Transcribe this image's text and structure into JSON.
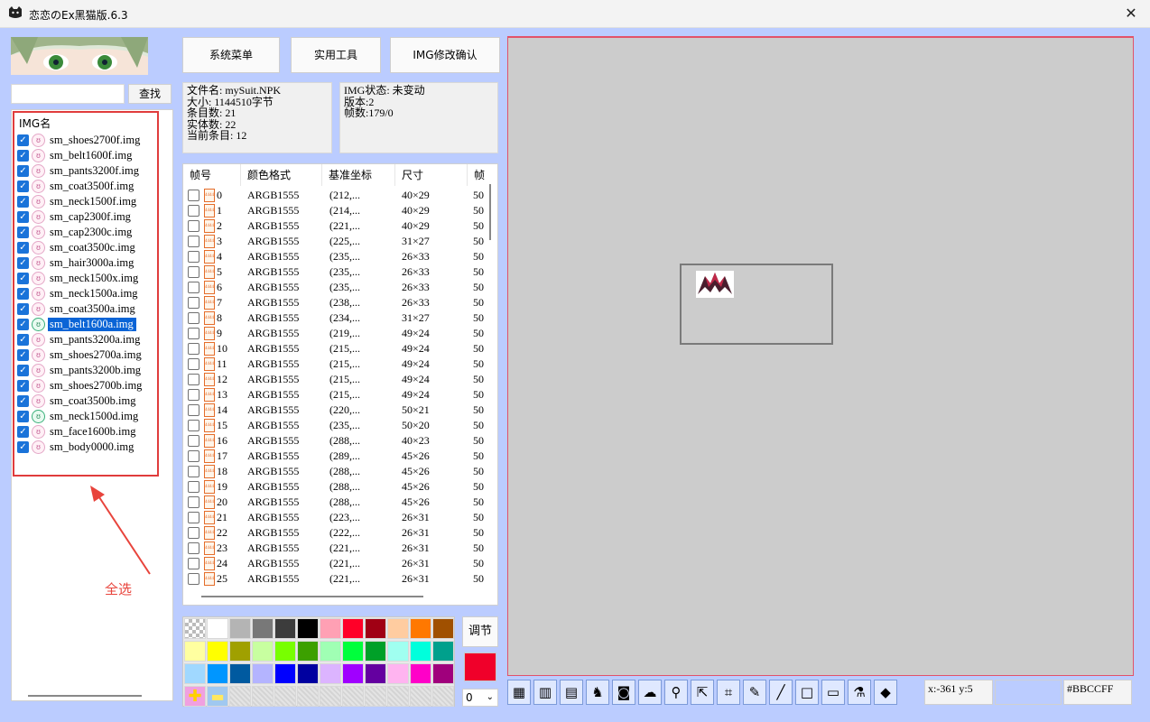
{
  "window": {
    "title": "恋恋のEx黑猫版.6.3",
    "close_symbol": "✕"
  },
  "search": {
    "value": "",
    "button_label": "查找"
  },
  "img_list": {
    "header": "IMG名",
    "items": [
      {
        "name": "sm_shoes2700f.img",
        "checked": true,
        "icon": "pig-icon"
      },
      {
        "name": "sm_belt1600f.img",
        "checked": true,
        "icon": "pig-icon"
      },
      {
        "name": "sm_pants3200f.img",
        "checked": true,
        "icon": "pig-icon"
      },
      {
        "name": "sm_coat3500f.img",
        "checked": true,
        "icon": "pig-icon"
      },
      {
        "name": "sm_neck1500f.img",
        "checked": true,
        "icon": "pig-icon"
      },
      {
        "name": "sm_cap2300f.img",
        "checked": true,
        "icon": "pig-icon"
      },
      {
        "name": "sm_cap2300c.img",
        "checked": true,
        "icon": "pig-icon"
      },
      {
        "name": "sm_coat3500c.img",
        "checked": true,
        "icon": "pig-icon"
      },
      {
        "name": "sm_hair3000a.img",
        "checked": true,
        "icon": "pig-icon"
      },
      {
        "name": "sm_neck1500x.img",
        "checked": true,
        "icon": "pig-icon"
      },
      {
        "name": "sm_neck1500a.img",
        "checked": true,
        "icon": "pig-icon"
      },
      {
        "name": "sm_coat3500a.img",
        "checked": true,
        "icon": "pig-icon"
      },
      {
        "name": "sm_belt1600a.img",
        "checked": true,
        "icon": "green-pig-icon",
        "selected": true
      },
      {
        "name": "sm_pants3200a.img",
        "checked": true,
        "icon": "pig-icon"
      },
      {
        "name": "sm_shoes2700a.img",
        "checked": true,
        "icon": "pig-icon"
      },
      {
        "name": "sm_pants3200b.img",
        "checked": true,
        "icon": "pig-icon"
      },
      {
        "name": "sm_shoes2700b.img",
        "checked": true,
        "icon": "pig-icon"
      },
      {
        "name": "sm_coat3500b.img",
        "checked": true,
        "icon": "pig-icon"
      },
      {
        "name": "sm_neck1500d.img",
        "checked": true,
        "icon": "green-pig-icon"
      },
      {
        "name": "sm_face1600b.img",
        "checked": true,
        "icon": "pig-icon"
      },
      {
        "name": "sm_body0000.img",
        "checked": true,
        "icon": "pig-icon"
      }
    ]
  },
  "annotation": {
    "text": "全选",
    "color": "#e8443c"
  },
  "buttons": {
    "system_menu": "系统菜单",
    "tools": "实用工具",
    "img_confirm": "IMG修改确认",
    "adjust": "调节"
  },
  "file_info": {
    "line1": "文件名: mySuit.NPK",
    "line2": "大小: 1144510字节",
    "line3": "条目数: 21",
    "line4": "实体数: 22",
    "line5": "当前条目: 12"
  },
  "img_info": {
    "line1": "IMG状态: 未变动",
    "line2": "版本:2",
    "line3": "帧数:179/0"
  },
  "frame_table": {
    "columns": [
      "帧号",
      "颜色格式",
      "基准坐标",
      "尺寸",
      "帧"
    ],
    "rows": [
      [
        "0",
        "ARGB1555",
        "(212,...",
        "40×29",
        "50"
      ],
      [
        "1",
        "ARGB1555",
        "(214,...",
        "40×29",
        "50"
      ],
      [
        "2",
        "ARGB1555",
        "(221,...",
        "40×29",
        "50"
      ],
      [
        "3",
        "ARGB1555",
        "(225,...",
        "31×27",
        "50"
      ],
      [
        "4",
        "ARGB1555",
        "(235,...",
        "26×33",
        "50"
      ],
      [
        "5",
        "ARGB1555",
        "(235,...",
        "26×33",
        "50"
      ],
      [
        "6",
        "ARGB1555",
        "(235,...",
        "26×33",
        "50"
      ],
      [
        "7",
        "ARGB1555",
        "(238,...",
        "26×33",
        "50"
      ],
      [
        "8",
        "ARGB1555",
        "(234,...",
        "31×27",
        "50"
      ],
      [
        "9",
        "ARGB1555",
        "(219,...",
        "49×24",
        "50"
      ],
      [
        "10",
        "ARGB1555",
        "(215,...",
        "49×24",
        "50"
      ],
      [
        "11",
        "ARGB1555",
        "(215,...",
        "49×24",
        "50"
      ],
      [
        "12",
        "ARGB1555",
        "(215,...",
        "49×24",
        "50"
      ],
      [
        "13",
        "ARGB1555",
        "(215,...",
        "49×24",
        "50"
      ],
      [
        "14",
        "ARGB1555",
        "(220,...",
        "50×21",
        "50"
      ],
      [
        "15",
        "ARGB1555",
        "(235,...",
        "50×20",
        "50"
      ],
      [
        "16",
        "ARGB1555",
        "(288,...",
        "40×23",
        "50"
      ],
      [
        "17",
        "ARGB1555",
        "(289,...",
        "45×26",
        "50"
      ],
      [
        "18",
        "ARGB1555",
        "(288,...",
        "45×26",
        "50"
      ],
      [
        "19",
        "ARGB1555",
        "(288,...",
        "45×26",
        "50"
      ],
      [
        "20",
        "ARGB1555",
        "(288,...",
        "45×26",
        "50"
      ],
      [
        "21",
        "ARGB1555",
        "(223,...",
        "26×31",
        "50"
      ],
      [
        "22",
        "ARGB1555",
        "(222,...",
        "26×31",
        "50"
      ],
      [
        "23",
        "ARGB1555",
        "(221,...",
        "26×31",
        "50"
      ],
      [
        "24",
        "ARGB1555",
        "(221,...",
        "26×31",
        "50"
      ],
      [
        "25",
        "ARGB1555",
        "(221,...",
        "26×31",
        "50"
      ]
    ],
    "frame_icon_text": "4444"
  },
  "palette": {
    "rows": [
      [
        "checker",
        "#ffffff",
        "#b4b4b4",
        "#787878",
        "#3c3c3c",
        "#000000",
        "#ffa0b4",
        "#ff0028",
        "#a00014",
        "#ffcca0",
        "#ff7800",
        "#a05000"
      ],
      [
        "#ffffa0",
        "#ffff00",
        "#a0a000",
        "#c8ffa0",
        "#78ff00",
        "#3ca000",
        "#a0ffb4",
        "#00ff3c",
        "#00a028",
        "#a0fff0",
        "#00ffdc",
        "#00a08c"
      ],
      [
        "#a0d8ff",
        "#0096ff",
        "#005aa0",
        "#b4b4ff",
        "#0000ff",
        "#0000a0",
        "#dcb4ff",
        "#a000ff",
        "#6400a0",
        "#ffb4f0",
        "#ff00c8",
        "#a0007c"
      ],
      [
        "add",
        "remove",
        "empty",
        "empty",
        "empty",
        "empty",
        "empty",
        "empty",
        "empty",
        "empty",
        "empty",
        "empty"
      ]
    ],
    "current_color": "#f0002a",
    "layer_value": "0"
  },
  "tools": [
    {
      "icon": "grid-icon",
      "glyph": "▦"
    },
    {
      "icon": "palette-icon",
      "glyph": "▥"
    },
    {
      "icon": "film-icon",
      "glyph": "▤"
    },
    {
      "icon": "cat-icon",
      "glyph": "♞"
    },
    {
      "icon": "camera-icon",
      "glyph": "◙"
    },
    {
      "icon": "cloud-icon",
      "glyph": "☁"
    },
    {
      "icon": "magnifier-icon",
      "glyph": "⚲"
    },
    {
      "icon": "move-icon",
      "glyph": "⇱"
    },
    {
      "icon": "crop-icon",
      "glyph": "⌗"
    },
    {
      "icon": "pencil-icon",
      "glyph": "✎"
    },
    {
      "icon": "line-icon",
      "glyph": "╱"
    },
    {
      "icon": "rectangle-icon",
      "glyph": "□"
    },
    {
      "icon": "eraser-icon",
      "glyph": "▭"
    },
    {
      "icon": "eyedropper-icon",
      "glyph": "⚗"
    },
    {
      "icon": "fill-icon",
      "glyph": "◆"
    }
  ],
  "status": {
    "coords": "x:-361 y:5",
    "hex": "#BBCCFF",
    "preview_color": "#bbccff"
  }
}
